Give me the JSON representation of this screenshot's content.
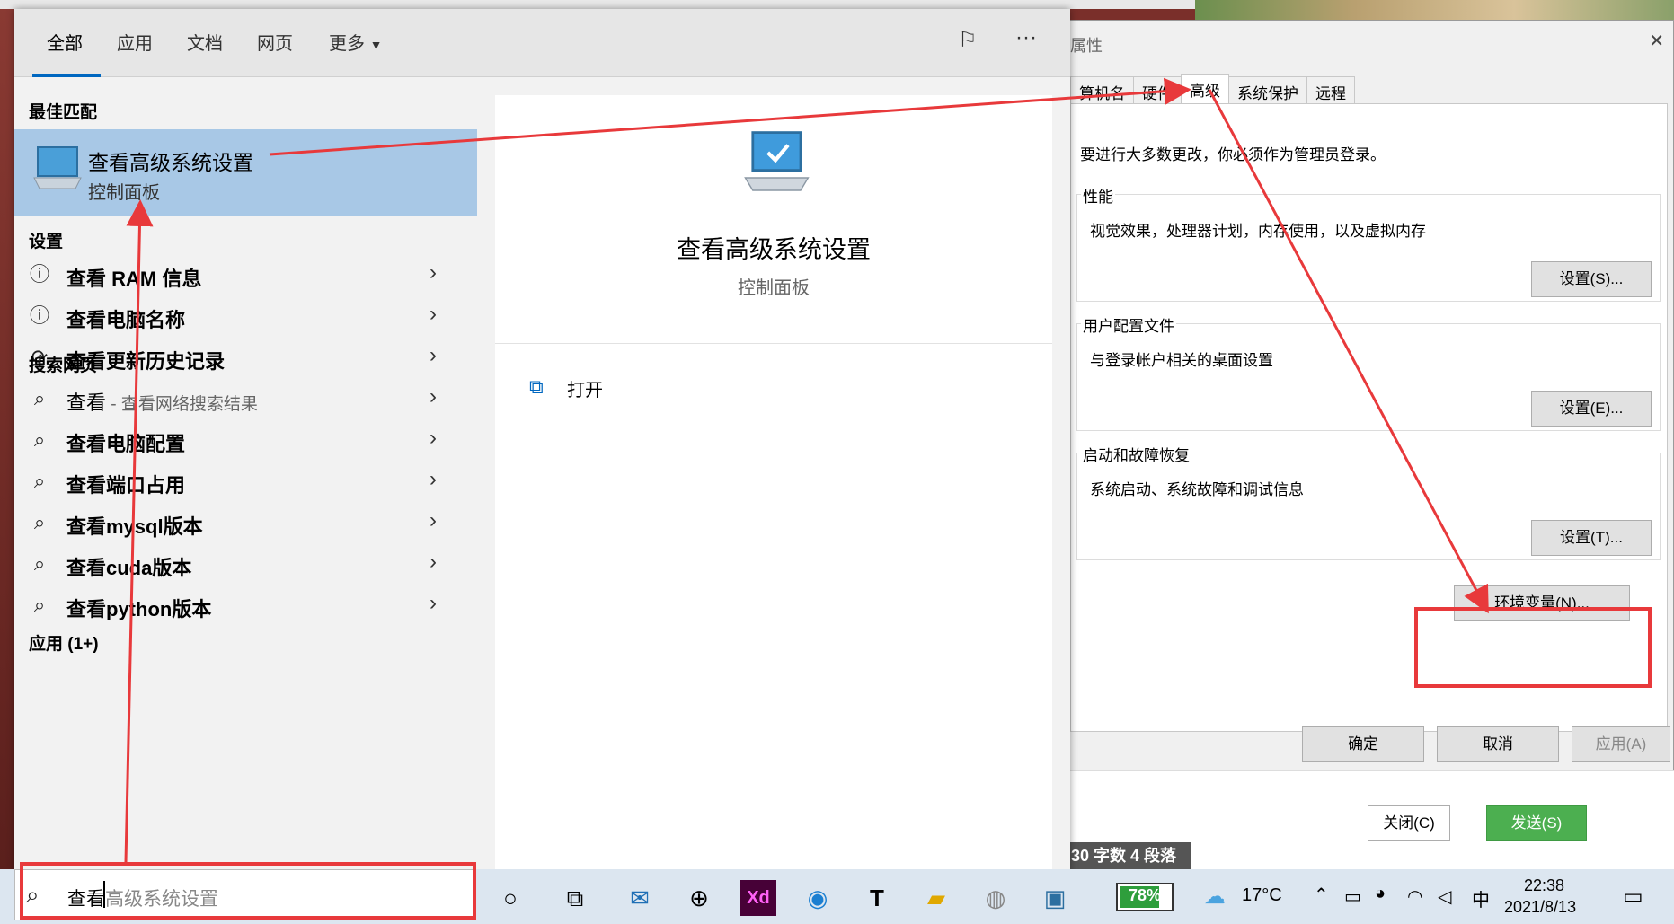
{
  "sysprop": {
    "title": "属性",
    "tabs": [
      "算机名",
      "硬件",
      "高级",
      "系统保护",
      "远程"
    ],
    "notice": "要进行大多数更改，你必须作为管理员登录。",
    "performance": {
      "title": "性能",
      "desc": "视觉效果，处理器计划，内存使用，以及虚拟内存",
      "button": "设置(S)..."
    },
    "profile": {
      "title": "用户配置文件",
      "desc": "与登录帐户相关的桌面设置",
      "button": "设置(E)..."
    },
    "startup": {
      "title": "启动和故障恢复",
      "desc": "系统启动、系统故障和调试信息",
      "button": "设置(T)..."
    },
    "env_button": "环境变量(N)...",
    "ok": "确定",
    "cancel": "取消",
    "apply": "应用(A)"
  },
  "chat": {
    "close": "关闭(C)",
    "send": "发送(S)",
    "wordcount": "30 字数  4 段落"
  },
  "search": {
    "tabs": {
      "all": "全部",
      "apps": "应用",
      "docs": "文档",
      "web": "网页",
      "more": "更多"
    },
    "best_match_header": "最佳匹配",
    "best_match": {
      "title": "查看高级系统设置",
      "subtitle": "控制面板"
    },
    "settings_header": "设置",
    "settings_items": [
      "查看 RAM 信息",
      "查看电脑名称",
      "查看更新历史记录"
    ],
    "web_header": "搜索网页",
    "web_items": [
      {
        "label": "查看",
        "sub": " - 查看网络搜索结果"
      },
      {
        "label": "查看电脑配置",
        "sub": ""
      },
      {
        "label": "查看端口占用",
        "sub": ""
      },
      {
        "label": "查看mysql版本",
        "sub": ""
      },
      {
        "label": "查看cuda版本",
        "sub": ""
      },
      {
        "label": "查看python版本",
        "sub": ""
      }
    ],
    "apps_header": "应用 (1+)",
    "preview": {
      "title": "查看高级系统设置",
      "subtitle": "控制面板",
      "open": "打开"
    },
    "query_typed": "查看",
    "query_rest": "高级系统设置"
  },
  "taskbar": {
    "battery": "78%",
    "battery_level": 0.78,
    "weather": "17°C",
    "ime": "中",
    "time": "22:38",
    "date": "2021/8/13"
  },
  "colors": {
    "accent": "#0067c0",
    "highlight": "#a8c8e6",
    "annotation": "#e8393b",
    "send": "#4caf50"
  }
}
